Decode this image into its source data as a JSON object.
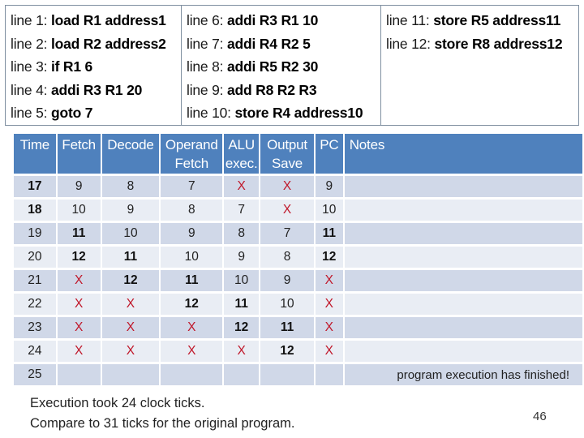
{
  "code": {
    "columns": [
      [
        {
          "prefix": "line 1: ",
          "instr": "load R1 address1"
        },
        {
          "prefix": "line 2: ",
          "instr": "load R2 address2"
        },
        {
          "prefix": "line 3: ",
          "instr": "if R1 6"
        },
        {
          "prefix": "line 4: ",
          "instr": "addi R3 R1 20"
        },
        {
          "prefix": "line 5: ",
          "instr": "goto 7"
        }
      ],
      [
        {
          "prefix": "line 6: ",
          "instr": "addi R3 R1 10"
        },
        {
          "prefix": "line 7: ",
          "instr": "addi R4 R2 5"
        },
        {
          "prefix": "line 8: ",
          "instr": "addi R5 R2 30"
        },
        {
          "prefix": "line 9: ",
          "instr": "add R8 R2 R3"
        },
        {
          "prefix": "line 10: ",
          "instr": "store R4 address10"
        }
      ],
      [
        {
          "prefix": "line 11: ",
          "instr": "store R5 address11"
        },
        {
          "prefix": "line 12: ",
          "instr": "store R8 address12"
        }
      ]
    ]
  },
  "table": {
    "headers": [
      "Time",
      "Fetch",
      "Decode",
      "Operand Fetch",
      "ALU exec.",
      "Output Save",
      "PC",
      "Notes"
    ],
    "rows": [
      [
        "17",
        "9",
        "8",
        "7",
        "X",
        "X",
        "9",
        ""
      ],
      [
        "18",
        "10",
        "9",
        "8",
        "7",
        "X",
        "10",
        ""
      ],
      [
        "19",
        "11",
        "10",
        "9",
        "8",
        "7",
        "11",
        ""
      ],
      [
        "20",
        "12",
        "11",
        "10",
        "9",
        "8",
        "12",
        ""
      ],
      [
        "21",
        "X",
        "12",
        "11",
        "10",
        "9",
        "X",
        ""
      ],
      [
        "22",
        "X",
        "X",
        "12",
        "11",
        "10",
        "X",
        ""
      ],
      [
        "23",
        "X",
        "X",
        "X",
        "12",
        "11",
        "X",
        ""
      ],
      [
        "24",
        "X",
        "X",
        "X",
        "X",
        "12",
        "X",
        ""
      ],
      [
        "25",
        "",
        "",
        "",
        "",
        "",
        "",
        "program execution has finished!"
      ]
    ]
  },
  "summary": {
    "line1": "Execution took 24 clock ticks.",
    "line2": "Compare to 31 ticks for the original program."
  },
  "page_number": "46",
  "colors": {
    "header_bg": "#4f81bd",
    "row_odd": "#d0d8e8",
    "row_even": "#e9edf4",
    "x_mark": "#c0182a"
  }
}
